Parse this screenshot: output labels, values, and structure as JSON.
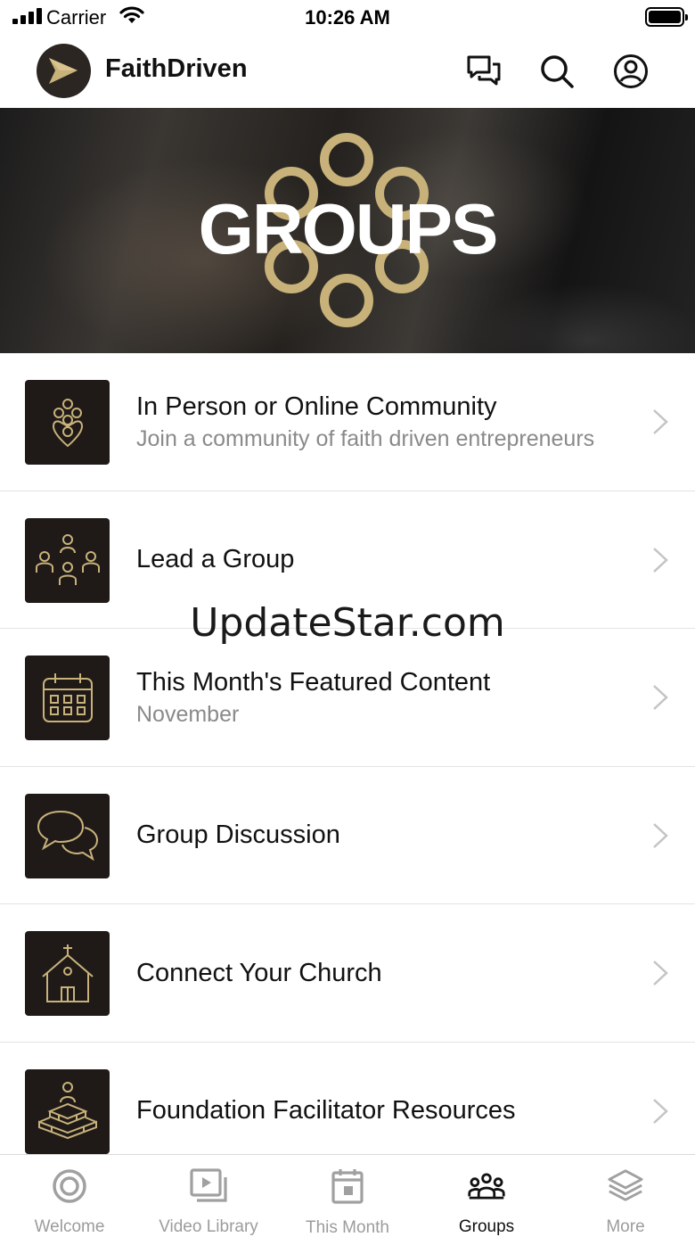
{
  "status_bar": {
    "carrier": "Carrier",
    "time": "10:26 AM"
  },
  "header": {
    "app_name": "FaithDriven",
    "icons": [
      "chat-bubbles-icon",
      "search-icon",
      "account-icon"
    ]
  },
  "hero": {
    "title": "GROUPS"
  },
  "items": [
    {
      "title": "In Person or Online Community",
      "subtitle": "Join a community of faith driven entrepreneurs",
      "icon": "location-people-icon"
    },
    {
      "title": "Lead a Group",
      "subtitle": "",
      "icon": "group-leader-icon"
    },
    {
      "title": "This Month's Featured Content",
      "subtitle": "November",
      "icon": "calendar-icon"
    },
    {
      "title": "Group Discussion",
      "subtitle": "",
      "icon": "discussion-icon"
    },
    {
      "title": "Connect Your Church",
      "subtitle": "",
      "icon": "church-icon"
    },
    {
      "title": "Foundation Facilitator Resources",
      "subtitle": "",
      "icon": "foundation-icon"
    }
  ],
  "watermark": "UpdateStar.com",
  "tabs": [
    {
      "label": "Welcome",
      "icon": "circle-icon",
      "active": false
    },
    {
      "label": "Video Library",
      "icon": "video-library-icon",
      "active": false
    },
    {
      "label": "This Month",
      "icon": "calendar-icon",
      "active": false
    },
    {
      "label": "Groups",
      "icon": "groups-icon",
      "active": true
    },
    {
      "label": "More",
      "icon": "layers-icon",
      "active": false
    }
  ],
  "colors": {
    "gold": "#c8b27a",
    "thumb_bg": "#1f1a18",
    "text_secondary": "#8a8a8a",
    "tab_inactive": "#9c9c9c"
  }
}
